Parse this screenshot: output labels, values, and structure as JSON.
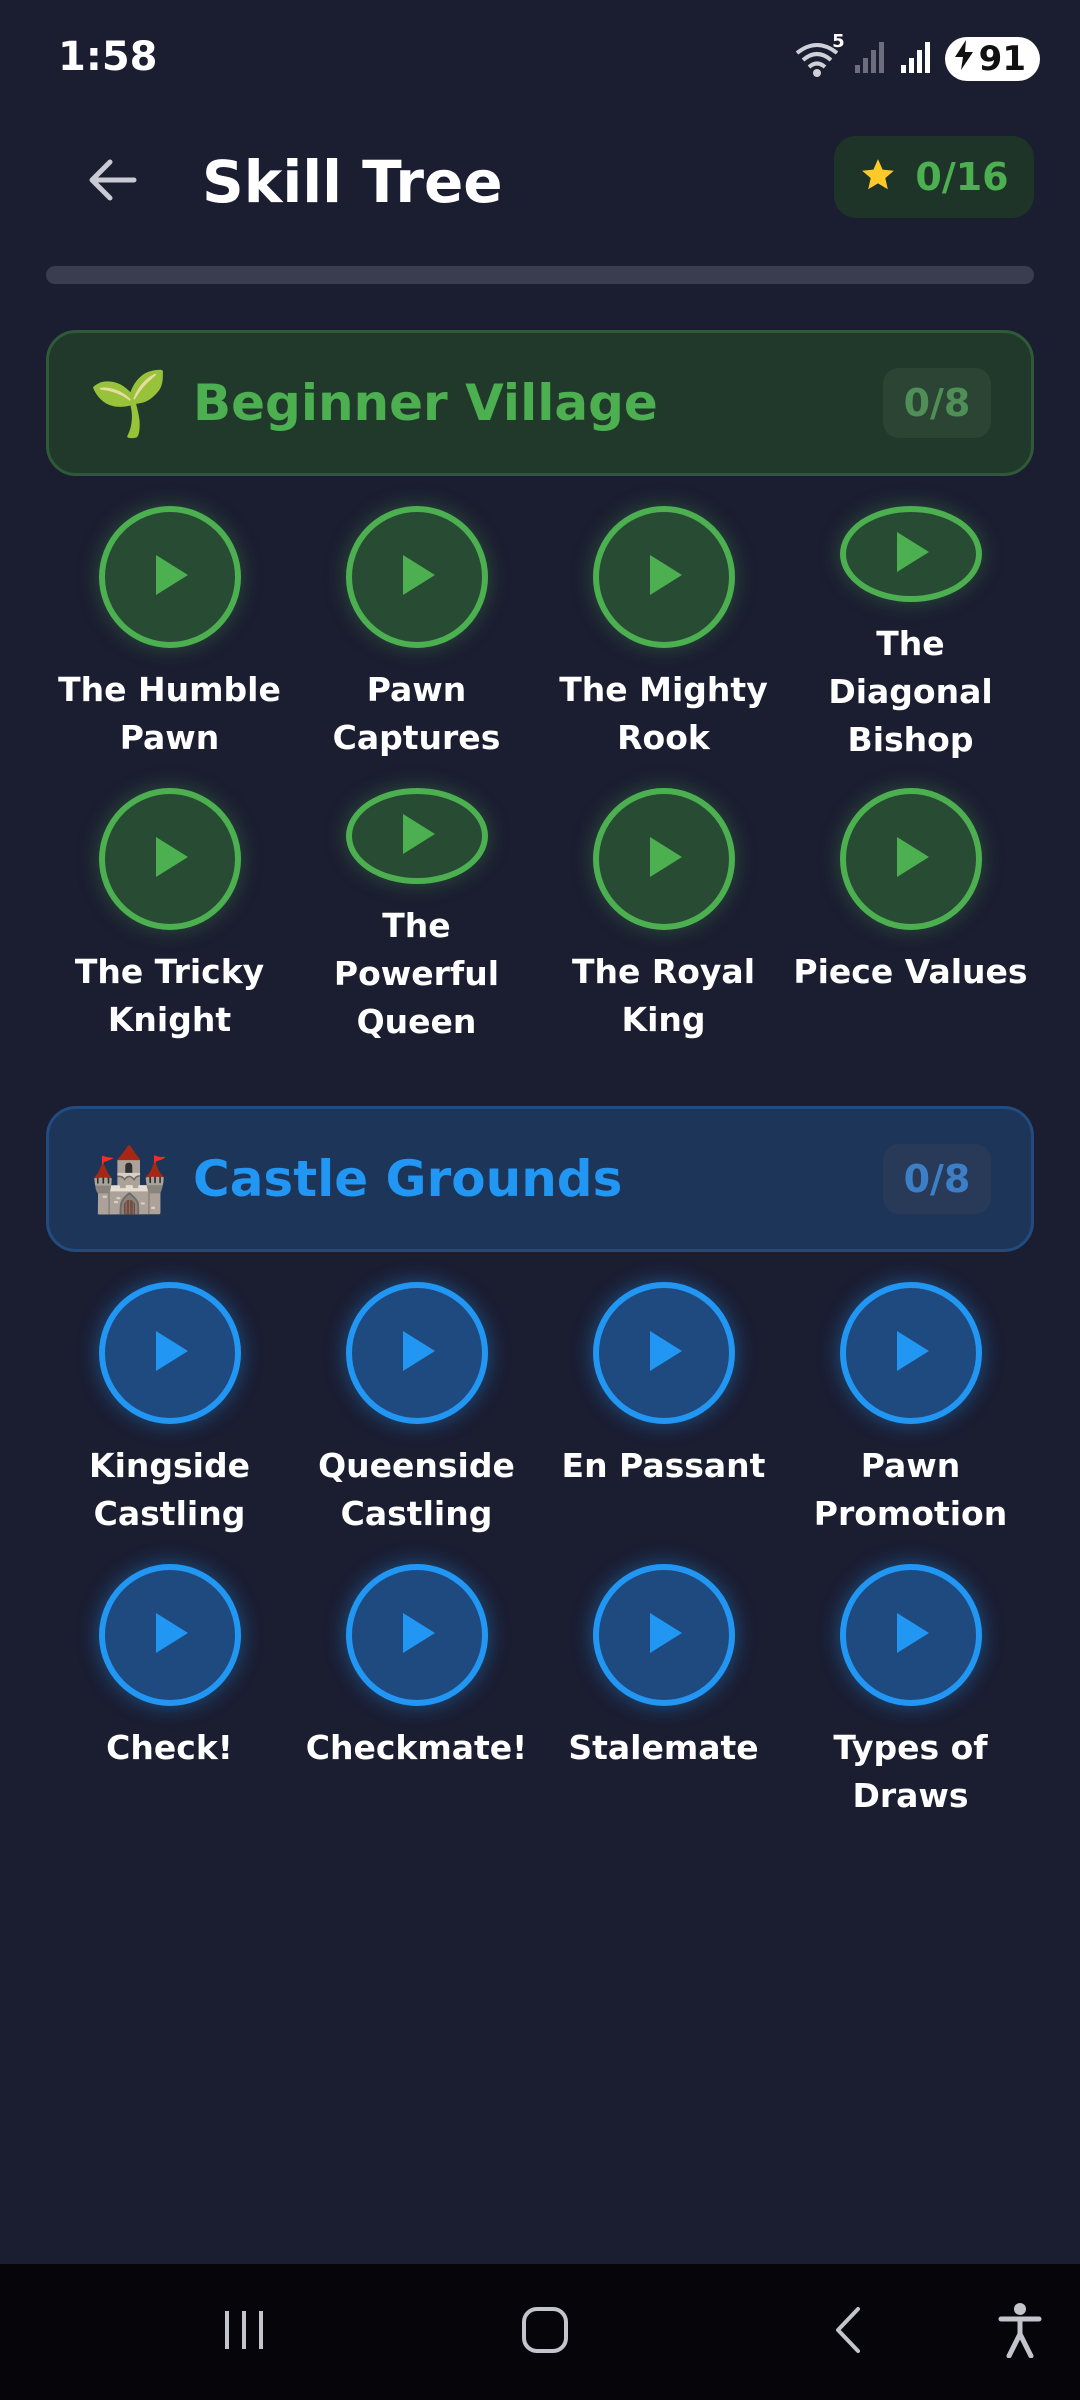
{
  "status_bar": {
    "time": "1:58",
    "wifi_badge": "5",
    "battery": "91"
  },
  "header": {
    "title": "Skill Tree",
    "stars": "0/16",
    "star_color": "#ffca28",
    "progress": 0
  },
  "sections": [
    {
      "emoji": "🌱",
      "title": "Beginner Village",
      "count": "0/8",
      "color": "#4caf50",
      "lessons": [
        {
          "label": "The Humble Pawn"
        },
        {
          "label": "Pawn Captures"
        },
        {
          "label": "The Mighty Rook"
        },
        {
          "label": "The Diagonal Bishop"
        },
        {
          "label": "The Tricky Knight"
        },
        {
          "label": "The Powerful Queen"
        },
        {
          "label": "The Royal King"
        },
        {
          "label": "Piece Values"
        }
      ]
    },
    {
      "emoji": "🏰",
      "title": "Castle Grounds",
      "count": "0/8",
      "color": "#2196f3",
      "lessons": [
        {
          "label": "Kingside Castling"
        },
        {
          "label": "Queenside Castling"
        },
        {
          "label": "En Passant"
        },
        {
          "label": "Pawn Promotion"
        },
        {
          "label": "Check!"
        },
        {
          "label": "Checkmate!"
        },
        {
          "label": "Stalemate"
        },
        {
          "label": "Types of Draws"
        }
      ]
    }
  ]
}
